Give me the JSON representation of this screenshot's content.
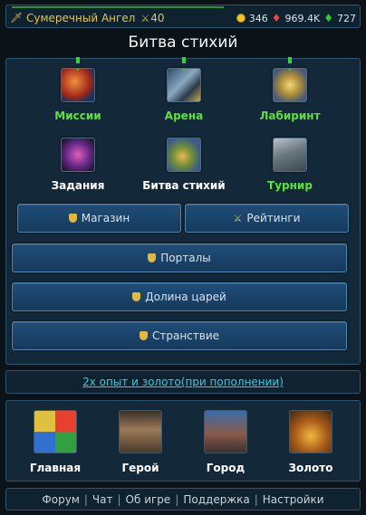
{
  "status": {
    "nickname": "Сумеречный Ангел",
    "level": "40",
    "gold": "346",
    "rubies": "969.4K",
    "emeralds": "727"
  },
  "title": "Битва стихий",
  "grid": [
    {
      "label": "Миссии",
      "icon": "missions-icon",
      "arrow": true,
      "color": "green"
    },
    {
      "label": "Арена",
      "icon": "arena-icon",
      "arrow": true,
      "color": "green"
    },
    {
      "label": "Лабиринт",
      "icon": "labyrinth-icon",
      "arrow": true,
      "color": "green"
    },
    {
      "label": "Задания",
      "icon": "quests-icon",
      "arrow": false,
      "color": "white"
    },
    {
      "label": "Битва стихий",
      "icon": "elements-battle-icon",
      "arrow": false,
      "color": "white"
    },
    {
      "label": "Турнир",
      "icon": "tournament-icon",
      "arrow": false,
      "color": "green"
    }
  ],
  "buttons": {
    "shop": "Магазин",
    "ratings": "Рейтинги",
    "portals": "Порталы",
    "kings_valley": "Долина царей",
    "wandering": "Странствие"
  },
  "promo": "2x опыт и золото(при пополнении)",
  "nav": [
    {
      "label": "Главная",
      "icon": "home-icon"
    },
    {
      "label": "Герой",
      "icon": "hero-icon"
    },
    {
      "label": "Город",
      "icon": "city-icon"
    },
    {
      "label": "Золото",
      "icon": "gold-chest-icon"
    }
  ],
  "footer": [
    "Форум",
    "Чат",
    "Об игре",
    "Поддержка",
    "Настройки"
  ]
}
